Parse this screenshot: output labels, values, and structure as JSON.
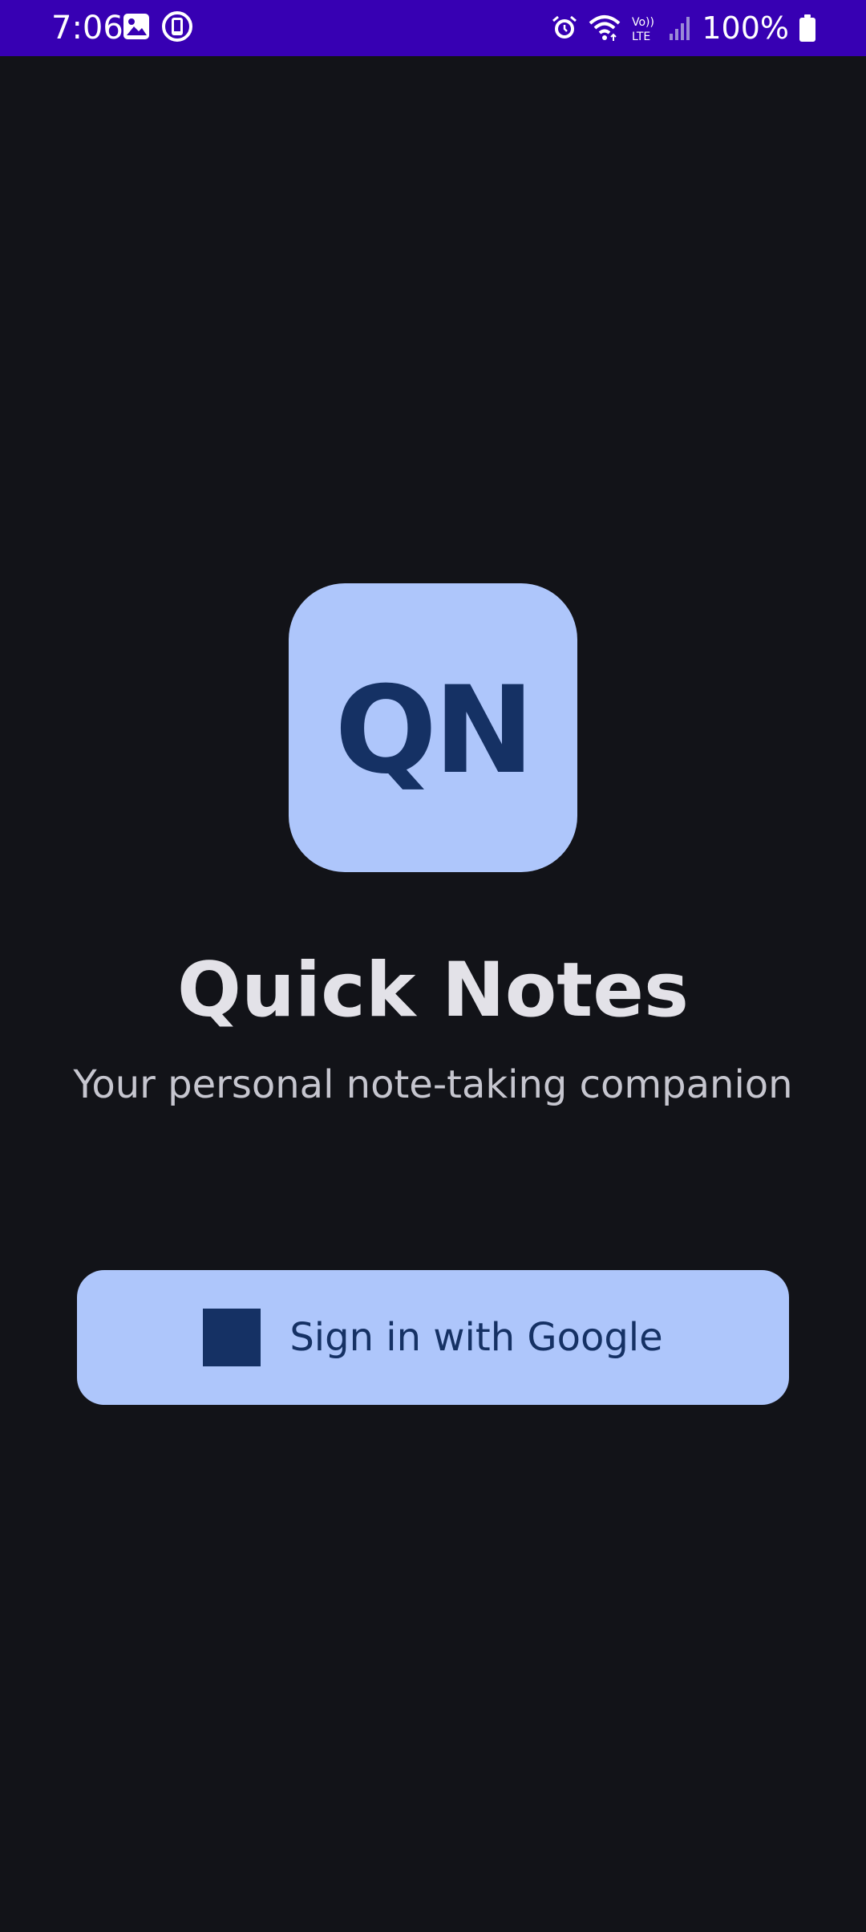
{
  "status_bar": {
    "time": "7:06",
    "battery_percent": "100%",
    "network_label_top": "Vo))",
    "network_label_bottom": "LTE",
    "background_color": "#3700b3",
    "left_icons": [
      "gallery-icon",
      "screen-record-icon"
    ],
    "right_icons": [
      "alarm-icon",
      "wifi-icon",
      "volte-icon",
      "signal-icon",
      "battery-icon"
    ]
  },
  "app": {
    "logo_text": "QN",
    "title": "Quick Notes",
    "subtitle": "Your personal note-taking companion"
  },
  "signin": {
    "label": "Sign in with Google",
    "icon": "google-icon"
  },
  "colors": {
    "background": "#121318",
    "accent": "#aec6fb",
    "on_accent": "#153164",
    "title_text": "#e3e2e8",
    "subtitle_text": "#c6c6cf"
  }
}
